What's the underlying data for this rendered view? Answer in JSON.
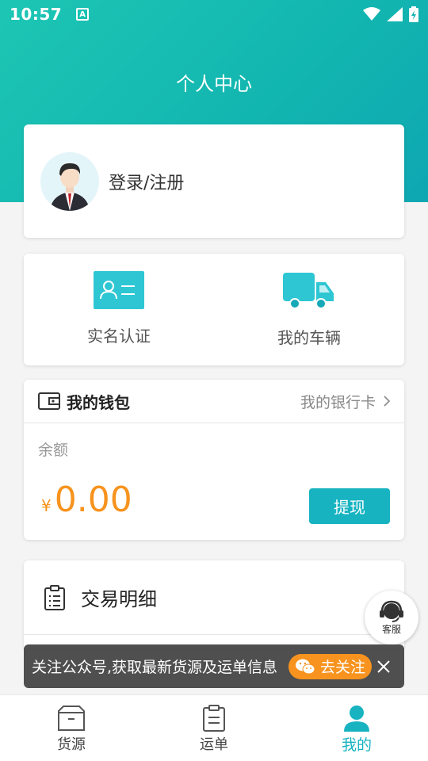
{
  "status_bar": {
    "time": "10:57",
    "notification_glyph": "A"
  },
  "header": {
    "title": "个人中心"
  },
  "profile": {
    "login_label": "登录/注册"
  },
  "quick_actions": [
    {
      "label": "实名认证",
      "icon": "id-card-icon"
    },
    {
      "label": "我的车辆",
      "icon": "truck-icon"
    }
  ],
  "wallet": {
    "title": "我的钱包",
    "bank_link": "我的银行卡",
    "balance_label": "余额",
    "currency": "¥",
    "amount": "0.00",
    "withdraw_label": "提现"
  },
  "transactions": {
    "label": "交易明细"
  },
  "customer_service": {
    "label": "客服"
  },
  "follow_banner": {
    "text": "关注公众号,获取最新货源及运单信息",
    "button_label": "去关注"
  },
  "tabs": [
    {
      "label": "货源",
      "icon": "box-icon",
      "active": false
    },
    {
      "label": "运单",
      "icon": "clipboard-icon",
      "active": false
    },
    {
      "label": "我的",
      "icon": "person-icon",
      "active": true
    }
  ],
  "colors": {
    "brand": "#17b3c1",
    "header_gradient": "#1dc6b4",
    "amount": "#f7931e",
    "follow_button": "#f7931e"
  }
}
